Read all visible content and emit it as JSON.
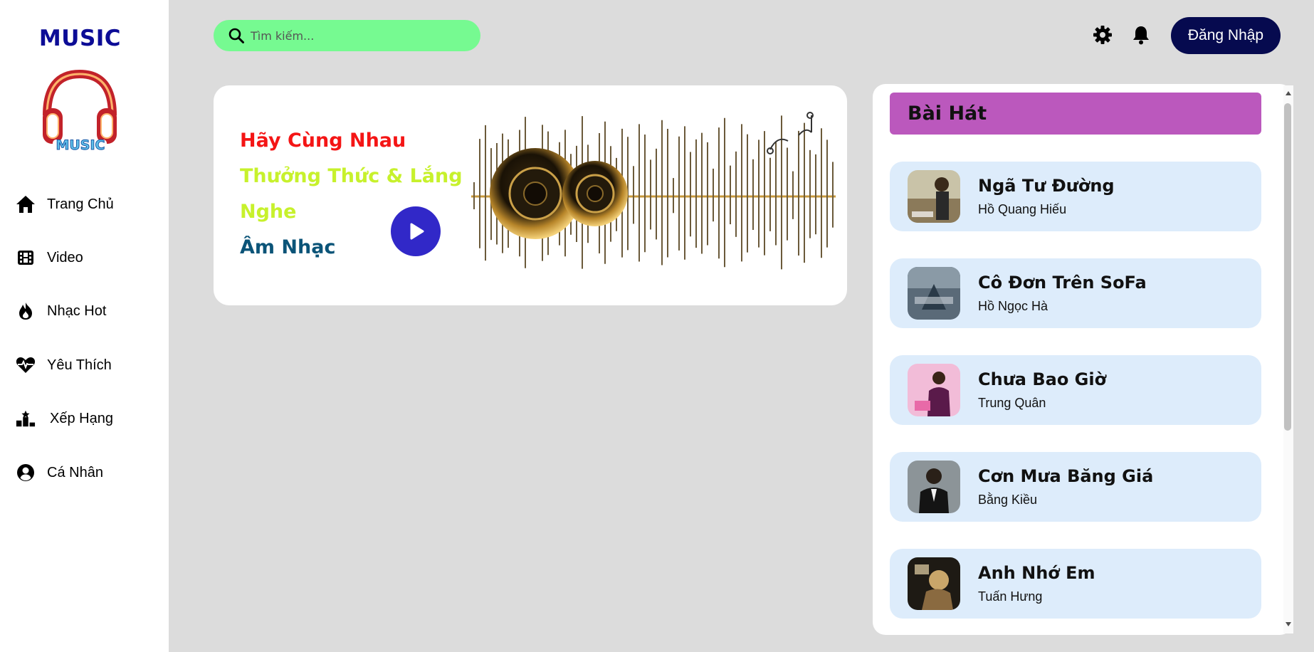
{
  "sidebar": {
    "brand": "MUSIC",
    "logo_text": "MUSIC",
    "items": [
      {
        "label": "Trang Chủ",
        "icon": "home-icon"
      },
      {
        "label": "Video",
        "icon": "film-icon"
      },
      {
        "label": "Nhạc Hot",
        "icon": "fire-icon"
      },
      {
        "label": "Yêu Thích",
        "icon": "heart-pulse-icon"
      },
      {
        "label": "Xếp Hạng",
        "icon": "ranking-icon"
      },
      {
        "label": "Cá Nhân",
        "icon": "user-circle-icon"
      }
    ]
  },
  "header": {
    "search_placeholder": "Tìm kiếm...",
    "login_label": "Đăng Nhập"
  },
  "hero": {
    "line1": "Hãy Cùng Nhau",
    "line2": "Thưởng Thức & Lắng",
    "line3": "Nghe",
    "line4": "Âm Nhạc"
  },
  "songs": {
    "title": "Bài Hát",
    "items": [
      {
        "title": "Ngã Tư Đường",
        "artist": "Hồ Quang Hiếu"
      },
      {
        "title": "Cô Đơn Trên SoFa",
        "artist": "Hồ Ngọc Hà"
      },
      {
        "title": "Chưa Bao Giờ",
        "artist": "Trung Quân"
      },
      {
        "title": "Cơn Mưa Băng Giá",
        "artist": "Bằng Kiều"
      },
      {
        "title": "Anh Nhớ Em",
        "artist": "Tuấn Hưng"
      }
    ]
  },
  "colors": {
    "sidebar_brand": "#0c0c96",
    "search_bg": "#76fa91",
    "login_bg": "#060a4f",
    "hero_line1": "#f41515",
    "hero_line2": "#c7f12c",
    "hero_line4": "#0b5478",
    "play_button": "#3128c8",
    "songs_header": "#bb58bd",
    "song_card": "#ddecfb"
  }
}
